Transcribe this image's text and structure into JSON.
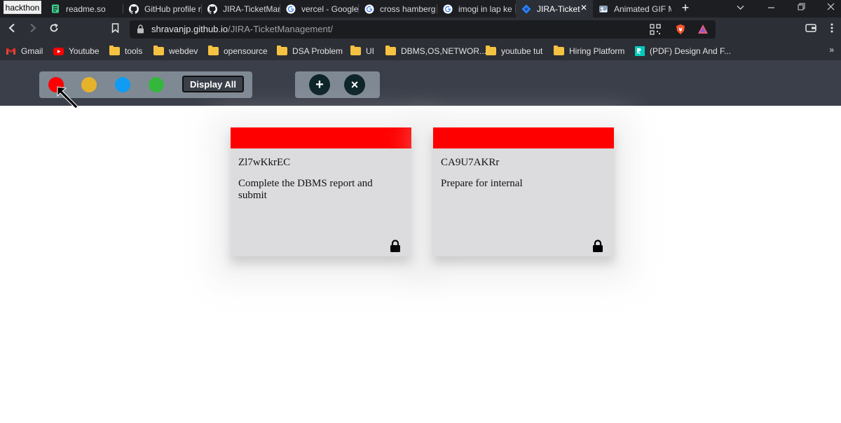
{
  "browser": {
    "tabs": [
      {
        "label": "hackthon",
        "icon": "hackthon-tab"
      },
      {
        "label": "readme.so",
        "icon": "readme-icon"
      },
      {
        "label": "GitHub profile r",
        "icon": "github-icon"
      },
      {
        "label": "JIRA-TicketMan",
        "icon": "github-icon"
      },
      {
        "label": "vercel - Google",
        "icon": "google-icon"
      },
      {
        "label": "cross hamberg",
        "icon": "google-icon"
      },
      {
        "label": "imogi in lap ke",
        "icon": "google-icon"
      },
      {
        "label": "JIRA-Ticket",
        "icon": "jira-icon",
        "active": true
      },
      {
        "label": "Animated GIF M",
        "icon": "gif-icon"
      }
    ],
    "new_tab_glyph": "+",
    "url_host": "shravanjp.github.io",
    "url_path": "/JIRA-TicketManagement/",
    "bookmarks": [
      {
        "label": "Gmail",
        "icon": "gmail-icon"
      },
      {
        "label": "Youtube",
        "icon": "youtube-icon"
      },
      {
        "label": "tools",
        "icon": "folder-icon"
      },
      {
        "label": "webdev",
        "icon": "folder-icon"
      },
      {
        "label": "opensource",
        "icon": "folder-icon"
      },
      {
        "label": "DSA Problem",
        "icon": "folder-icon"
      },
      {
        "label": "UI",
        "icon": "folder-icon"
      },
      {
        "label": "DBMS,OS,NETWOR...",
        "icon": "folder-icon"
      },
      {
        "label": "youtube tut",
        "icon": "folder-icon"
      },
      {
        "label": "Hiring Platform",
        "icon": "folder-icon"
      },
      {
        "label": "(PDF) Design And F...",
        "icon": "researchgate-icon"
      }
    ],
    "bookmarks_more": "»"
  },
  "toolbar": {
    "colors": [
      "#ff0000",
      "#e6b12b",
      "#0f9cf2",
      "#35b63c"
    ],
    "display_all_label": "Display All",
    "add_glyph": "+",
    "remove_glyph": "×"
  },
  "tickets": [
    {
      "id": "Zl7wKkrEC",
      "description": "Complete the DBMS report and submit",
      "color": "#ff0000"
    },
    {
      "id": "CA9U7AKRr",
      "description": "Prepare for internal",
      "color": "#ff0000"
    }
  ]
}
